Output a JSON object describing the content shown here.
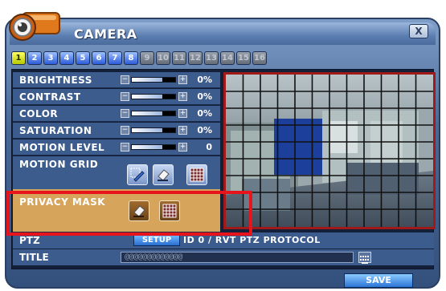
{
  "window": {
    "title": "CAMERA",
    "close_label": "X"
  },
  "tabs": [
    {
      "label": "1",
      "state": "active"
    },
    {
      "label": "2",
      "state": "on"
    },
    {
      "label": "3",
      "state": "on"
    },
    {
      "label": "4",
      "state": "on"
    },
    {
      "label": "5",
      "state": "on"
    },
    {
      "label": "6",
      "state": "on"
    },
    {
      "label": "7",
      "state": "on"
    },
    {
      "label": "8",
      "state": "on"
    },
    {
      "label": "9",
      "state": "off"
    },
    {
      "label": "10",
      "state": "off"
    },
    {
      "label": "11",
      "state": "off"
    },
    {
      "label": "12",
      "state": "off"
    },
    {
      "label": "13",
      "state": "off"
    },
    {
      "label": "14",
      "state": "off"
    },
    {
      "label": "15",
      "state": "off"
    },
    {
      "label": "16",
      "state": "off"
    }
  ],
  "settings": {
    "brightness": {
      "label": "BRIGHTNESS",
      "value": "0%"
    },
    "contrast": {
      "label": "CONTRAST",
      "value": "0%"
    },
    "color": {
      "label": "COLOR",
      "value": "0%"
    },
    "saturation": {
      "label": "SATURATION",
      "value": "0%"
    },
    "motion_level": {
      "label": "MOTION LEVEL",
      "value": "0"
    }
  },
  "motion_grid": {
    "label": "MOTION GRID"
  },
  "privacy_mask": {
    "label": "PRIVACY MASK"
  },
  "ptz": {
    "label": "PTZ",
    "setup_label": "SETUP",
    "protocol": "ID 0 / RVT PTZ PROTOCOL"
  },
  "title_field": {
    "label": "TITLE",
    "value": "@@@@@@@@@@@@@"
  },
  "save_label": "SAVE",
  "colors": {
    "accent": "#d7a45c",
    "highlight": "#e8141c",
    "row_bg": "#3d5c8e"
  }
}
